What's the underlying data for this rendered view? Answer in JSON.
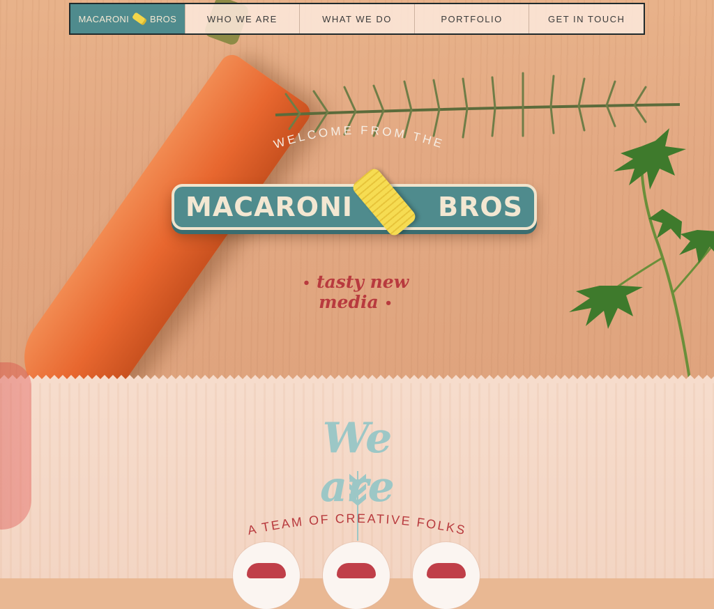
{
  "nav": {
    "brand_left": "MACARONI",
    "brand_right": "BROS",
    "items": [
      {
        "label": "WHO WE ARE"
      },
      {
        "label": "WHAT WE DO"
      },
      {
        "label": "PORTFOLIO"
      },
      {
        "label": "GET IN TOUCH"
      }
    ]
  },
  "hero": {
    "welcome": "WELCOME FROM THE",
    "logo_left": "MACARONI",
    "logo_right": "BROS",
    "tagline": "tasty new media"
  },
  "about": {
    "heading": "We are",
    "subheading": "A TEAM OF CREATIVE FOLKS"
  },
  "colors": {
    "teal": "#4f8b8d",
    "cream": "#f3e7d2",
    "tagline_red": "#b83a3e",
    "pale_teal": "#9cc7c6",
    "pasta_yellow": "#f2d64a"
  }
}
